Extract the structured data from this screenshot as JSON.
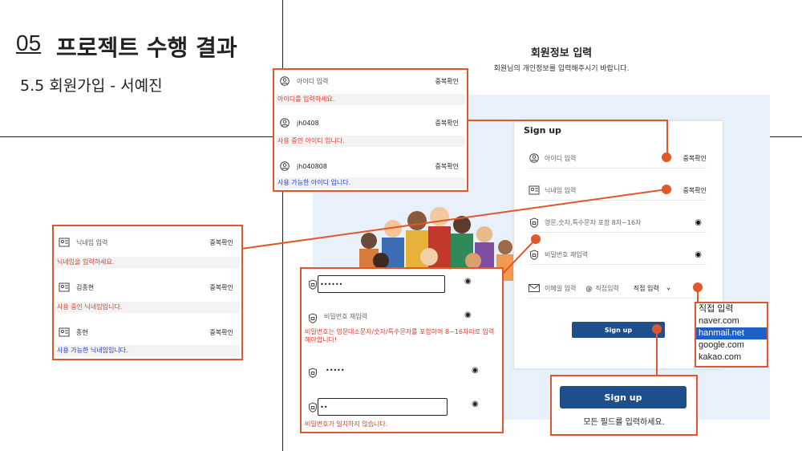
{
  "slide": {
    "section_number": "05",
    "section_title": "프로젝트 수행 결과",
    "subtitle": "5.5 회원가입 - 서예진"
  },
  "page": {
    "heading": "회원정보 입력",
    "subheading": "회원님의 개인정보를 입력해주시기 바랍니다."
  },
  "signup_form": {
    "title": "Sign up",
    "id_placeholder": "아이디 입력",
    "check_dup": "중복확인",
    "nickname_placeholder": "닉네임 입력",
    "password_placeholder": "영문,숫자,특수문자 포함 8자~16자",
    "password_confirm_placeholder": "비밀번호 재입력",
    "email_placeholder": "이메일 입력",
    "at": "@",
    "domain_placeholder": "직접입력",
    "domain_select": "직접 입력",
    "submit": "Sign up"
  },
  "id_box": {
    "rows": [
      {
        "value": "아이디 입력",
        "button": "중복확인",
        "message": "아이디를 입력하세요."
      },
      {
        "value": "jh0408",
        "button": "중복확인",
        "message": "사용 중인 아이디 입니다."
      },
      {
        "value": "jh040808",
        "button": "중복확인",
        "message": "사용 가능한 아이디 입니다."
      }
    ]
  },
  "nickname_box": {
    "rows": [
      {
        "value": "닉네임 입력",
        "button": "중복확인",
        "message": "닉네임을 입력하세요."
      },
      {
        "value": "김종현",
        "button": "중복확인",
        "message": "사용 중인 닉네임입니다."
      },
      {
        "value": "종현",
        "button": "중복확인",
        "message": "사용 가능한 닉네임입니다."
      }
    ]
  },
  "password_box": {
    "pw1": "••••••",
    "confirm_placeholder": "비밀번호 재입력",
    "rule_message": "비밀번호는 영문대소문자/숫자/특수문자를 포함하여 8~16자리로 입력해야합니다!",
    "pw2": "•••••",
    "pw3": "••",
    "mismatch_message": "비밀번호가 일치하지 않습니다."
  },
  "email_dropdown": {
    "options": [
      "직접 입력",
      "naver.com",
      "hanmail.net",
      "google.com",
      "kakao.com"
    ],
    "selected_index": 2
  },
  "submit_box": {
    "button": "Sign up",
    "note": "모든 필드를 입력하세요."
  },
  "colors": {
    "accent": "#e0572b",
    "button": "#1e4f8a",
    "error": "#e03a2a",
    "ok": "#1a3bd6",
    "panel_bg": "#e8f1fb"
  }
}
